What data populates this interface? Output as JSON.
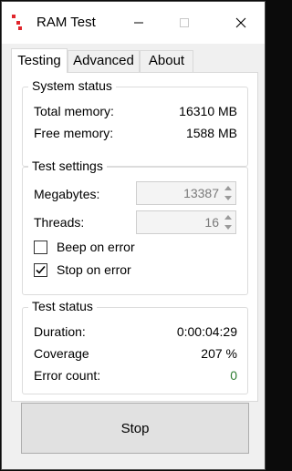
{
  "window": {
    "title": "RAM Test"
  },
  "tabs": [
    {
      "label": "Testing",
      "active": true
    },
    {
      "label": "Advanced",
      "active": false
    },
    {
      "label": "About",
      "active": false
    }
  ],
  "system_status": {
    "title": "System status",
    "total_label": "Total memory:",
    "total_value": "16310 MB",
    "free_label": "Free memory:",
    "free_value": "1588 MB"
  },
  "test_settings": {
    "title": "Test settings",
    "megabytes_label": "Megabytes:",
    "megabytes_value": "13387",
    "threads_label": "Threads:",
    "threads_value": "16",
    "beep_label": "Beep on error",
    "beep_checked": false,
    "stop_label": "Stop on error",
    "stop_checked": true
  },
  "test_status": {
    "title": "Test status",
    "duration_label": "Duration:",
    "duration_value": "0:00:04:29",
    "coverage_label": "Coverage",
    "coverage_value": "207 %",
    "errors_label": "Error count:",
    "errors_value": "0"
  },
  "actions": {
    "stop_label": "Stop"
  },
  "colors": {
    "error_count_ok": "#2e7d32",
    "app_icon": "#e0262c"
  },
  "icons": [
    "app-icon",
    "minimize-icon",
    "maximize-icon",
    "close-icon",
    "spin-up-icon",
    "spin-down-icon",
    "checkmark-icon"
  ]
}
